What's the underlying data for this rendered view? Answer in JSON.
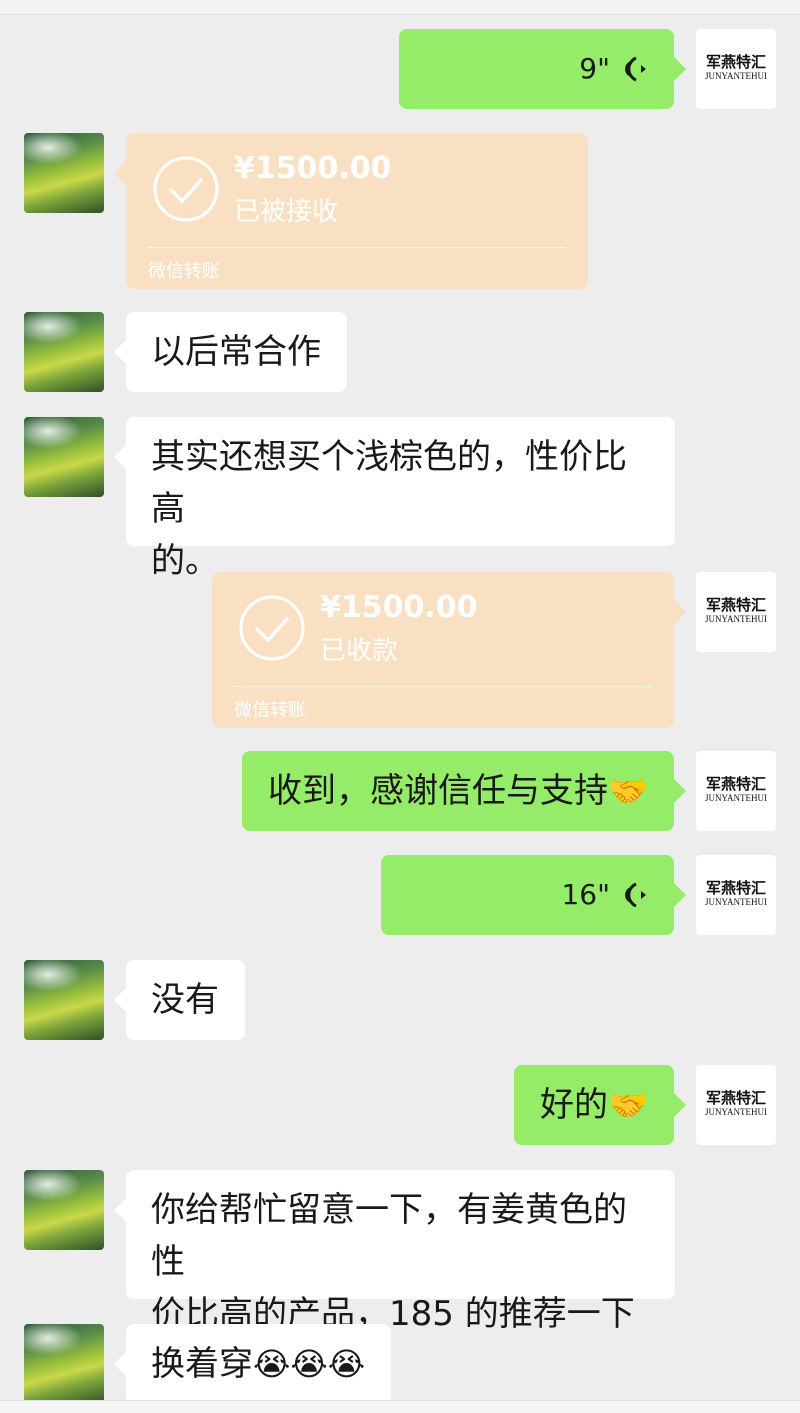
{
  "colors": {
    "background": "#ededed",
    "bubble_green": "#95ec69",
    "bubble_white": "#ffffff",
    "transfer": "#fae0c3"
  },
  "self_avatar": {
    "line1": "军燕特汇",
    "line2": "JUNYANTEHUI"
  },
  "messages": [
    {
      "type": "voice",
      "side": "right",
      "duration": "9\""
    },
    {
      "type": "transfer",
      "side": "left",
      "amount": "¥1500.00",
      "status": "已被接收",
      "footer": "微信转账"
    },
    {
      "type": "text",
      "side": "left",
      "text": "以后常合作"
    },
    {
      "type": "text",
      "side": "left",
      "line1": "其实还想买个浅棕色的，性价比高",
      "line2": "的。"
    },
    {
      "type": "transfer",
      "side": "right",
      "amount": "¥1500.00",
      "status": "已收款",
      "footer": "微信转账"
    },
    {
      "type": "text",
      "side": "right",
      "text": "收到，感谢信任与支持",
      "emoji": "🤝"
    },
    {
      "type": "voice",
      "side": "right",
      "duration": "16\""
    },
    {
      "type": "text",
      "side": "left",
      "text": "没有"
    },
    {
      "type": "text",
      "side": "right",
      "text": "好的",
      "emoji": "🤝"
    },
    {
      "type": "text",
      "side": "left",
      "line1": "你给帮忙留意一下，有姜黄色的性",
      "line2": "价比高的产品，185 的推荐一下"
    },
    {
      "type": "text",
      "side": "left",
      "text": "换着穿",
      "emoji": "😭😭😭"
    }
  ]
}
